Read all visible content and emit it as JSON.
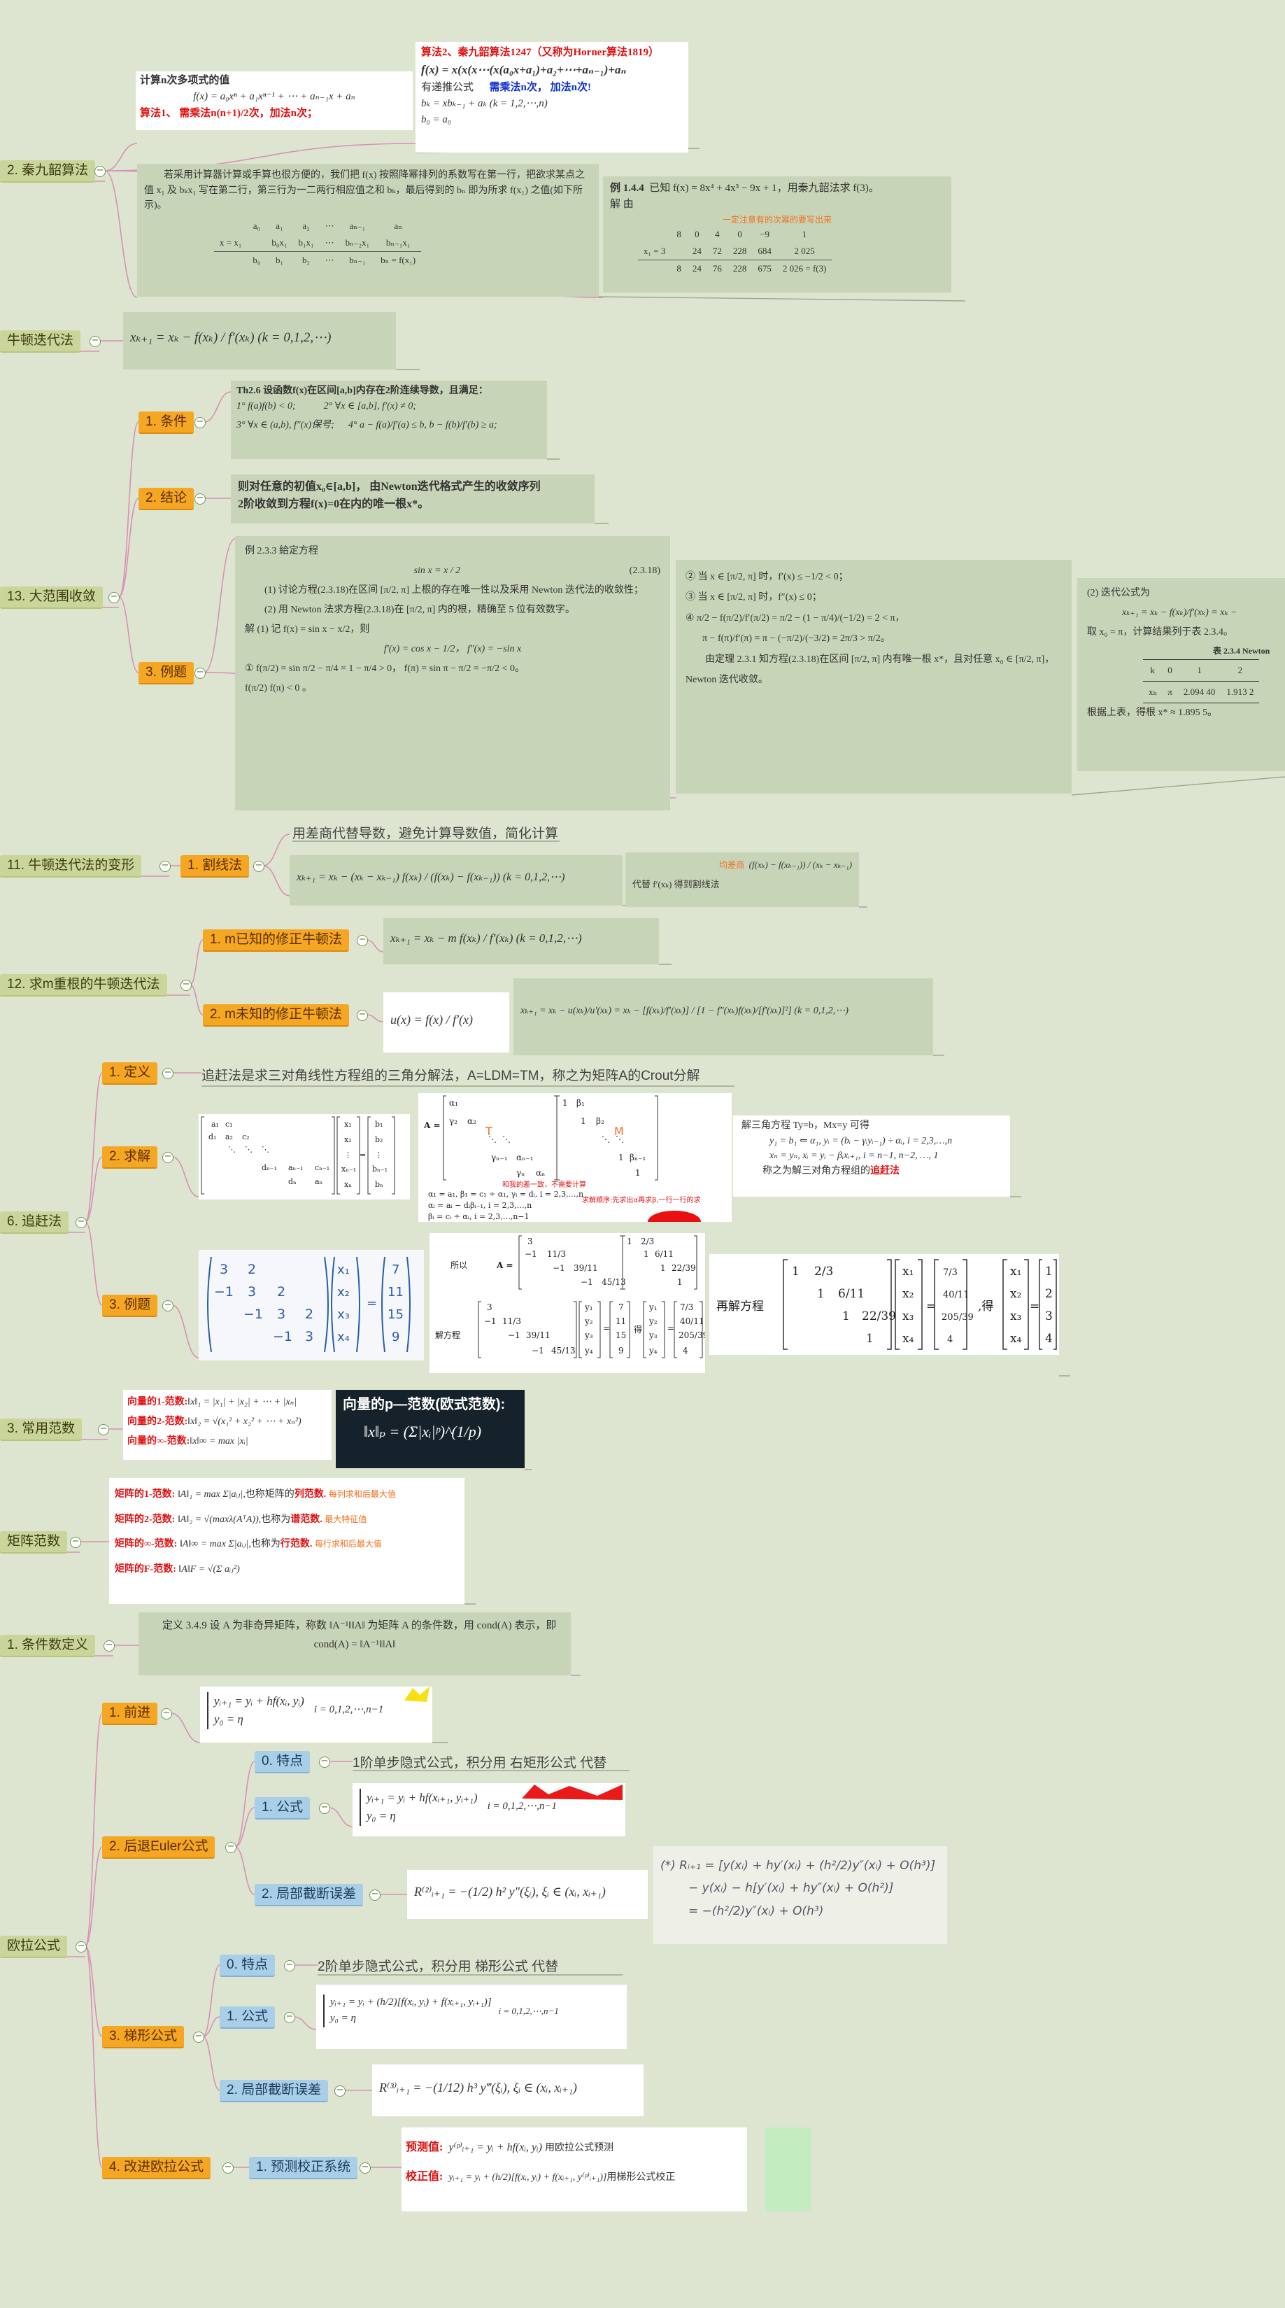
{
  "branches": {
    "qinjiushao": "2. 秦九韶算法",
    "newton": "牛顿迭代法",
    "global": "13. 大范围收敛",
    "cond": "1. 条件",
    "concl": "2. 结论",
    "example": "3. 例题",
    "variant": "11. 牛顿迭代法的变形",
    "secant": "1. 割线法",
    "multi": "12. 求m重根的牛顿迭代法",
    "m_known": "1. m已知的修正牛顿法",
    "m_unknown": "2. m未知的修正牛顿法",
    "chase": "6. 追赶法",
    "def": "1. 定义",
    "solve": "2. 求解",
    "chase_ex": "3. 例题",
    "vnorm": "3. 常用范数",
    "mnorm": "矩阵范数",
    "condnum": "1. 条件数定义",
    "euler": "欧拉公式",
    "forward": "1. 前进",
    "backward": "2. 后退Euler公式",
    "trap": "3. 梯形公式",
    "improved": "4. 改进欧拉公式",
    "feature0": "0. 特点",
    "formula1": "1. 公式",
    "localerr": "2. 局部截断误差",
    "feature0b": "0. 特点",
    "formula1b": "1. 公式",
    "localerrb": "2. 局部截断误差",
    "pc": "1. 预测校正系统"
  },
  "notes": {
    "secant_note": "用差商代替导数，避免计算导数值，简化计算",
    "chase_def": "追赶法是求三对角线性方程组的三角分解法，A=LDM=TM，称之为矩阵A的Crout分解",
    "back_feature": "1阶单步隐式公式，积分用  右矩形公式  代替",
    "trap_feature": "2阶单步隐式公式，积分用  梯形公式  代替"
  },
  "horner": {
    "title": "计算n次多项式的值",
    "poly": "f(x) = a₀xⁿ + a₁xⁿ⁻¹ + ⋯ + aₙ₋₁x + aₙ",
    "alg1": "算法1、 需乘法n(n+1)/2次，加法n次；",
    "alg2_title": "算法2、秦九韶算法1247（又称为Horner算法1819）",
    "alg2_formula": "f(x) = x(x(x⋯(x(a₀x+a₁)+a₂+⋯+aₙ₋₁)+aₙ",
    "recur": "有递推公式",
    "cost": "需乘法n次，  加法n次!",
    "recur1": "bₖ = xbₖ₋₁ + aₖ    (k = 1,2,⋯,n)",
    "recur2": "b₀ = a₀",
    "desc": "若采用计算器计算或手算也很方便的，我们把 f(x) 按照降幂排列的系数写在第一行，把欲求某点之值 x₁ 及 bₖx₁ 写在第二行，第三行为一二两行相应值之和 bₖ，最后得到的 bₙ 即为所求 f(x₁) 之值(如下所示)。",
    "tbl_r1": [
      "a₀",
      "a₁",
      "a₂",
      "⋯",
      "aₙ₋₁",
      "aₙ"
    ],
    "tbl_r2": [
      "",
      "b₀x₁",
      "b₁x₁",
      "⋯",
      "bₙ₋₂x₁",
      "bₙ₋₁x₁"
    ],
    "tbl_r3": [
      "b₀",
      "b₁",
      "b₂",
      "⋯",
      "bₙ₋₁",
      "bₙ = f(x₁)"
    ],
    "tbl_x": "x = x₁",
    "ex_title": "例 1.4.4",
    "ex_text": "已知 f(x) = 8x⁴ + 4x³ − 9x + 1，用秦九韶法求 f(3)。",
    "ex_sol": "解  由",
    "ex_hint": "一定注意有的次幂的要写出来",
    "ex_r1": [
      "8",
      "0",
      "4",
      "0",
      "−9",
      "1"
    ],
    "ex_r2": [
      "",
      "24",
      "72",
      "228",
      "684",
      "2 025"
    ],
    "ex_r3": [
      "8",
      "24",
      "76",
      "228",
      "675",
      "2 026 = f(3)"
    ],
    "ex_x": "x₁ = 3"
  },
  "newton_formula": "xₖ₊₁ = xₖ − f(xₖ) / f′(xₖ)    (k = 0,1,2,⋯)",
  "global": {
    "th": "Th2.6 设函数f(x)在区间[a,b]内存在2阶连续导数，且满足：",
    "c1": "1° f(a)f(b) < 0;",
    "c2": "2° ∀x ∈ [a,b], f′(x) ≠ 0;",
    "c3": "3° ∀x ∈ (a,b), f″(x)保号;",
    "c4": "4° a − f(a)/f′(a) ≤ b, b − f(b)/f′(b) ≥ a;",
    "concl1": "则对任意的初值x₀∈[a,b]，  由Newton迭代格式产生的收敛序列",
    "concl2": "2阶收敛到方程f(x)=0在内的唯一根x*。",
    "ex_title": "例 2.3.3    給定方程",
    "ex_eq": "sin x = x / 2",
    "ex_num": "(2.3.18)",
    "ex_1": "(1) 讨论方程(2.3.18)在区间 [π/2, π] 上根的存在唯一性以及采用 Newton 迭代法的收敛性；",
    "ex_2": "(2) 用 Newton 法求方程(2.3.18)在 [π/2, π] 内的根，精确至 5 位有效数字。",
    "ex_sol": "解  (1) 记 f(x) = sin x − x/2，则",
    "ex_der": "f′(x) = cos x − 1/2，  f″(x) = −sin x",
    "ex_f1": "① f(π/2) = sin π/2 − π/4 = 1 − π/4 > 0，  f(π) = sin π − π/2 = −π/2 < 0。",
    "ex_f2": "f(π/2) f(π) < 0 。",
    "ex_p2": "② 当 x ∈ [π/2, π] 时，f′(x) ≤ −1/2 < 0；",
    "ex_p3": "③ 当 x ∈ [π/2, π] 时，f″(x) ≤ 0；",
    "ex_p4": "④ π/2 − f(π/2)/f′(π/2) = π/2 − (1 − π/4)/(−1/2) = 2 < π，",
    "ex_p5": "π − f(π)/f′(π) = π − (−π/2)/(−3/2) = 2π/3 > π/2。",
    "ex_p6": "由定理 2.3.1 知方程(2.3.18)在区间 [π/2, π] 内有唯一根 x*，且对任意 x₀ ∈ [π/2, π]，Newton 迭代收敛。",
    "ex_q": "(2) 迭代公式为",
    "ex_q_formula": "xₖ₊₁ = xₖ − f(xₖ)/f′(xₖ) = xₖ −",
    "ex_q2": "取 x₀ = π，计算结果列于表 2.3.4。",
    "ex_tbl_title": "表 2.3.4    Newton",
    "ex_tbl_h": [
      "k",
      "0",
      "1",
      "2"
    ],
    "ex_tbl_r": [
      "xₖ",
      "π",
      "2.094 40",
      "1.913 2"
    ],
    "ex_q3": "根据上表，得根 x* ≈ 1.895 5。"
  },
  "secant": {
    "formula": "xₖ₊₁ = xₖ − (xₖ − xₖ₋₁) f(xₖ) / (f(xₖ) − f(xₖ₋₁))    (k = 0,1,2,⋯)",
    "diff_label": "均差商",
    "diff_formula": "(f(xₖ) − f(xₖ₋₁)) / (xₖ − xₖ₋₁)",
    "replace": "代替 f′(xₖ) 得到割线法"
  },
  "multi": {
    "known": "xₖ₊₁ = xₖ − m f(xₖ) / f′(xₖ)    (k = 0,1,2,⋯)",
    "u": "u(x) = f(x) / f′(x)",
    "unknown": "xₖ₊₁ = xₖ − u(xₖ)/u′(xₖ) = xₖ − [f(xₖ)/f′(xₖ)] / [1 − f″(xₖ)f(xₖ)/[f′(xₖ)]²]    (k = 0,1,2,⋯)"
  },
  "chase": {
    "solve_note": "解三角方程 Ty=b，Mx=y 可得",
    "solve1": "y₁ = b₁ ⇐ α₁,  yᵢ = (bᵢ − γᵢyᵢ₋₁) ÷ αᵢ, i = 2,3,…,n",
    "solve2": "xₙ = yₙ,  xᵢ = yᵢ − βᵢxᵢ₊₁, i = n−1, n−2, …, 1",
    "solve3": "称之为解三对角方程组的",
    "solve3_red": "追赶法",
    "m_label": "M",
    "t_label": "T",
    "hint1": "和我的差一致，不需要计算",
    "hint2": "求解顺序:先求出α再求β,一行一行的求",
    "rec1": "α₁ = a₁, β₁ = c₁ ÷ α₁, γᵢ = dᵢ, i = 2,3,…,n",
    "rec2": "αᵢ = aᵢ − dᵢβᵢ₋₁, i = 2,3,…,n",
    "rec3": "βᵢ = cᵢ ÷ αᵢ, i = 2,3,…,n−1",
    "suoyi": "所以",
    "jiefangcheng": "解方程",
    "de": "得",
    "zaijie": "再解方程",
    "ex_b": [
      "7",
      "11",
      "15",
      "9"
    ],
    "ex_x": [
      "x₁",
      "x₂",
      "x₃",
      "x₄"
    ],
    "ex_y": [
      "7/3",
      "40/11",
      "205/39",
      "4"
    ],
    "ex_res": [
      "1",
      "2",
      "3",
      "4"
    ]
  },
  "vnorm": {
    "n1": "向量的1-范数:",
    "n1f": "‖x‖₁ = |x₁| + |x₂| + ⋯ + |xₙ|",
    "n2": "向量的2-范数:",
    "n2f": "‖x‖₂ = √(x₁² + x₂² + ⋯ + xₙ²)",
    "ninf": "向量的∞-范数:",
    "ninff": "‖x‖∞ = max |xᵢ|",
    "p_title": "向量的p—范数(欧式范数):",
    "p_formula": "‖x‖ₚ = (Σ|xᵢ|ᵖ)^(1/p)"
  },
  "mnorm": {
    "n1": "矩阵的1-范数:",
    "n1f": "‖A‖₁ = max Σ|aᵢⱼ|",
    "n1t": ",也称矩阵的",
    "n1r": "列范数.",
    "n1o": "每列求和后最大值",
    "n2": "矩阵的2-范数:",
    "n2f": "‖A‖₂ = √(maxλ(AᵀA))",
    "n2t": ",也称为",
    "n2r": "谱范数.",
    "n2o": "最大特征值",
    "ninf": "矩阵的∞-范数:",
    "ninff": "‖A‖∞ = max Σ|aᵢⱼ|",
    "ninft": ",也称为",
    "ninfr": "行范数.",
    "ninfo": "每行求和后最大值",
    "nf": "矩阵的F-范数:",
    "nff": "‖A‖F = √(Σ aᵢⱼ²)"
  },
  "condnum": {
    "def": "定义 3.4.9    设 A 为非奇异矩阵，称数 ‖A⁻¹‖‖A‖ 为矩阵 A 的条件数，用 cond(A) 表示，即",
    "formula": "cond(A) = ‖A⁻¹‖‖A‖"
  },
  "euler": {
    "fwd1": "yᵢ₊₁ = yᵢ + hf(xᵢ, yᵢ)",
    "fwd2": "y₀ = η",
    "fwd3": "i = 0,1,2,⋯,n−1",
    "bwd1": "yᵢ₊₁ = yᵢ + hf(xᵢ₊₁, yᵢ₊₁)",
    "bwd2": "y₀ = η",
    "bwd3": "i = 0,1,2,⋯,n−1",
    "bwd_err": "R⁽²⁾ᵢ₊₁ = −(1/2) h² y″(ξᵢ),  ξᵢ ∈ (xᵢ, xᵢ₊₁)",
    "hand1": "(*) Rᵢ₊₁ = [y(xᵢ) + hy′(xᵢ) + (h²/2)y″(xᵢ) + O(h³)]",
    "hand2": "− y(xᵢ) − h[y′(xᵢ) + hy″(xᵢ) + O(h²)]",
    "hand3": "= −(h²/2)y″(xᵢ) + O(h³)",
    "trap1": "yᵢ₊₁ = yᵢ + (h/2)[f(xᵢ, yᵢ) + f(xᵢ₊₁, yᵢ₊₁)]",
    "trap2": "y₀ = η",
    "trap3": "i = 0,1,2,⋯,n−1",
    "trap_err": "R⁽³⁾ᵢ₊₁ = −(1/12) h³ y‴(ξᵢ),  ξᵢ ∈ (xᵢ, xᵢ₊₁)",
    "pred_label": "预测值:",
    "pred": "y⁽ᵖ⁾ᵢ₊₁ = yᵢ + hf(xᵢ, yᵢ)",
    "pred_note": "用欧拉公式预测",
    "corr_label": "校正值:",
    "corr": "yᵢ₊₁ = yᵢ + (h/2)[f(xᵢ, yᵢ) + f(xᵢ₊₁, y⁽ᵖ⁾ᵢ₊₁)]",
    "corr_note": "用梯形公式校正"
  },
  "colors": {
    "background": "#dde5d0",
    "level1": "#c9d59a",
    "level2": "#f5a623",
    "level3": "#a9cfe8",
    "branch_line": "#d98fb6"
  }
}
